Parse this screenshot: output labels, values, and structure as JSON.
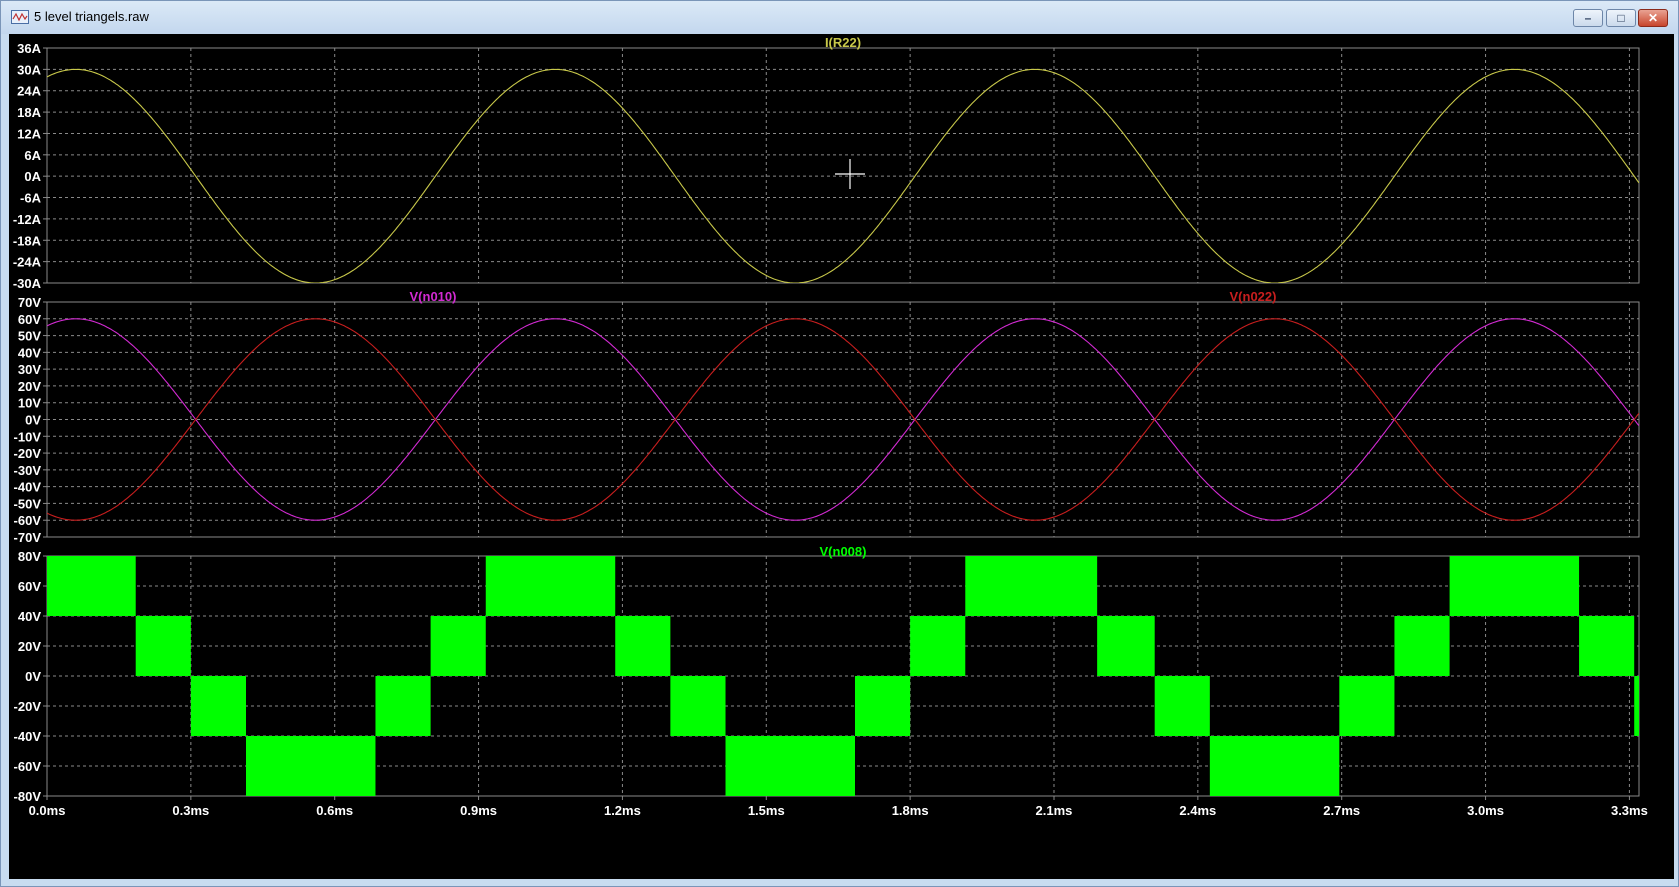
{
  "window": {
    "title": "5 level triangels.raw",
    "minimize_glyph": "–",
    "maximize_glyph": "□",
    "close_glyph": "✕",
    "icon": "waveform-file-icon"
  },
  "colors": {
    "background": "#000000",
    "grid": "#8a8a8a",
    "axis_text": "#ffffff",
    "current_trace": "#c8c84a",
    "n010_trace": "#d22ad2",
    "n022_trace": "#c81e1e",
    "n008_trace": "#00ff00"
  },
  "x_axis": {
    "ticks": [
      "0.0ms",
      "0.3ms",
      "0.6ms",
      "0.9ms",
      "1.2ms",
      "1.5ms",
      "1.8ms",
      "2.1ms",
      "2.4ms",
      "2.7ms",
      "3.0ms",
      "3.3ms"
    ],
    "tick_values": [
      0.0,
      0.3,
      0.6,
      0.9,
      1.2,
      1.5,
      1.8,
      2.1,
      2.4,
      2.7,
      3.0,
      3.3
    ],
    "range_ms": [
      0,
      3.32
    ]
  },
  "panes": [
    {
      "id": "current",
      "traces": [
        {
          "name": "I(R22)",
          "color_key": "current_trace"
        }
      ],
      "y_ticks": [
        "36A",
        "30A",
        "24A",
        "18A",
        "12A",
        "6A",
        "0A",
        "-6A",
        "-12A",
        "-18A",
        "-24A",
        "-30A"
      ],
      "y_range": [
        -30,
        36
      ]
    },
    {
      "id": "triangles",
      "traces": [
        {
          "name": "V(n010)",
          "color_key": "n010_trace"
        },
        {
          "name": "V(n022)",
          "color_key": "n022_trace"
        }
      ],
      "y_ticks": [
        "70V",
        "60V",
        "50V",
        "40V",
        "30V",
        "20V",
        "10V",
        "0V",
        "-10V",
        "-20V",
        "-30V",
        "-40V",
        "-50V",
        "-60V",
        "-70V"
      ],
      "y_range": [
        -70,
        70
      ]
    },
    {
      "id": "output",
      "traces": [
        {
          "name": "V(n008)",
          "color_key": "n008_trace"
        }
      ],
      "y_ticks": [
        "80V",
        "60V",
        "40V",
        "20V",
        "0V",
        "-20V",
        "-40V",
        "-60V",
        "-80V"
      ],
      "y_range": [
        -80,
        80
      ]
    }
  ],
  "chart_data": [
    {
      "type": "line",
      "title": "I(R22)",
      "xlabel": "",
      "ylabel": "",
      "ylim": [
        -30,
        36
      ],
      "xlim_ms": [
        0,
        3.32
      ],
      "grid": true,
      "series": [
        {
          "name": "I(R22)",
          "shape": "sinusoid",
          "amplitude": 30,
          "period_ms": 1.0,
          "peak_at_ms": 0.06,
          "x": [
            0.0,
            0.06,
            0.3,
            0.56,
            0.8,
            1.06,
            1.3,
            1.56,
            1.8,
            2.06,
            2.3,
            2.56,
            2.8,
            3.06,
            3.32
          ],
          "y": [
            28.1,
            30,
            0,
            -30,
            0,
            30,
            0,
            -30,
            0,
            30,
            0,
            -30,
            0,
            30,
            -3
          ]
        }
      ]
    },
    {
      "type": "line",
      "title": "",
      "xlabel": "",
      "ylabel": "",
      "ylim": [
        -70,
        70
      ],
      "xlim_ms": [
        0,
        3.32
      ],
      "grid": true,
      "series": [
        {
          "name": "V(n010)",
          "shape": "sinusoid",
          "amplitude": 60,
          "period_ms": 1.0,
          "peak_at_ms": 0.06,
          "x": [
            0.0,
            0.06,
            0.31,
            0.56,
            0.81,
            1.06,
            1.31,
            1.56,
            1.81,
            2.06,
            2.31,
            2.56,
            2.81,
            3.06,
            3.32
          ],
          "y": [
            56,
            60,
            0,
            -60,
            0,
            60,
            0,
            -60,
            0,
            60,
            0,
            -60,
            0,
            60,
            -3
          ]
        },
        {
          "name": "V(n022)",
          "shape": "sinusoid",
          "amplitude": 60,
          "period_ms": 1.0,
          "peak_at_ms": 0.56,
          "x": [
            0.0,
            0.06,
            0.31,
            0.56,
            0.81,
            1.06,
            1.31,
            1.56,
            1.81,
            2.06,
            2.31,
            2.56,
            2.81,
            3.06,
            3.32
          ],
          "y": [
            -56,
            -60,
            0,
            60,
            0,
            -60,
            0,
            60,
            0,
            -60,
            0,
            60,
            0,
            -60,
            3
          ]
        }
      ]
    },
    {
      "type": "area",
      "title": "V(n008)",
      "xlabel": "",
      "ylabel": "",
      "ylim": [
        -80,
        80
      ],
      "xlim_ms": [
        0,
        3.32
      ],
      "grid": true,
      "series": [
        {
          "name": "V(n008)",
          "shape": "pwm switching bands",
          "bands": [
            {
              "x0": 0.0,
              "x1": 0.185,
              "low": 40,
              "high": 80
            },
            {
              "x0": 0.185,
              "x1": 0.3,
              "low": 0,
              "high": 40
            },
            {
              "x0": 0.3,
              "x1": 0.415,
              "low": -40,
              "high": 0
            },
            {
              "x0": 0.415,
              "x1": 0.685,
              "low": -80,
              "high": -40
            },
            {
              "x0": 0.685,
              "x1": 0.8,
              "low": -40,
              "high": 0
            },
            {
              "x0": 0.8,
              "x1": 0.915,
              "low": 0,
              "high": 40
            },
            {
              "x0": 0.915,
              "x1": 1.185,
              "low": 40,
              "high": 80
            },
            {
              "x0": 1.185,
              "x1": 1.3,
              "low": 0,
              "high": 40
            },
            {
              "x0": 1.3,
              "x1": 1.415,
              "low": -40,
              "high": 0
            },
            {
              "x0": 1.415,
              "x1": 1.685,
              "low": -80,
              "high": -40
            },
            {
              "x0": 1.685,
              "x1": 1.8,
              "low": -40,
              "high": 0
            },
            {
              "x0": 1.8,
              "x1": 1.915,
              "low": 0,
              "high": 40
            },
            {
              "x0": 1.915,
              "x1": 2.19,
              "low": 40,
              "high": 80
            },
            {
              "x0": 2.19,
              "x1": 2.31,
              "low": 0,
              "high": 40
            },
            {
              "x0": 2.31,
              "x1": 2.425,
              "low": -40,
              "high": 0
            },
            {
              "x0": 2.425,
              "x1": 2.695,
              "low": -80,
              "high": -40
            },
            {
              "x0": 2.695,
              "x1": 2.81,
              "low": -40,
              "high": 0
            },
            {
              "x0": 2.81,
              "x1": 2.925,
              "low": 0,
              "high": 40
            },
            {
              "x0": 2.925,
              "x1": 3.195,
              "low": 40,
              "high": 80
            },
            {
              "x0": 3.195,
              "x1": 3.31,
              "low": 0,
              "high": 40
            },
            {
              "x0": 3.31,
              "x1": 3.32,
              "low": -40,
              "high": 0
            }
          ]
        }
      ]
    }
  ]
}
